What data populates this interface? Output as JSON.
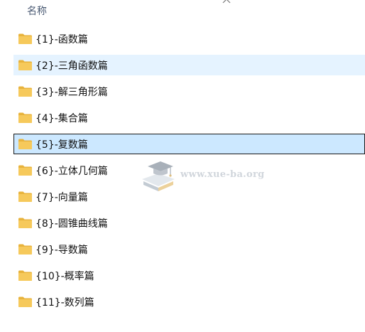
{
  "header": {
    "name_column": "名称"
  },
  "folders": [
    {
      "label": "{1}-函数篇",
      "state": "normal"
    },
    {
      "label": "{2}-三角函数篇",
      "state": "hover"
    },
    {
      "label": "{3}-解三角形篇",
      "state": "normal"
    },
    {
      "label": "{4}-集合篇",
      "state": "normal"
    },
    {
      "label": "{5}-复数篇",
      "state": "selected"
    },
    {
      "label": "{6}-立体几何篇",
      "state": "normal"
    },
    {
      "label": "{7}-向量篇",
      "state": "normal"
    },
    {
      "label": "{8}-圆锥曲线篇",
      "state": "normal"
    },
    {
      "label": "{9}-导数篇",
      "state": "normal"
    },
    {
      "label": "{10}-概率篇",
      "state": "normal"
    },
    {
      "label": "{11}-数列篇",
      "state": "normal"
    }
  ],
  "watermark": {
    "text": "www.xue-ba.org"
  },
  "colors": {
    "folder": "#f6c95b",
    "hover": "#e5f3ff",
    "selected": "#cce8ff"
  },
  "icons": {
    "folder": "folder-icon",
    "collapse": "chevron-up-icon",
    "watermark_logo": "graduation-cap-book-icon"
  }
}
